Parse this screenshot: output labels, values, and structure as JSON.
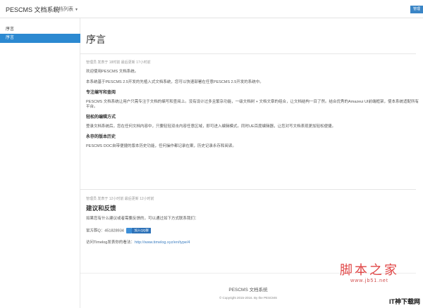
{
  "topbar": {
    "brand": "PESCMS 文档系统",
    "doc_list": "文档列表",
    "button": "管理"
  },
  "sidebar": {
    "heading": "序言",
    "active_item": "序言"
  },
  "main": {
    "title": "序言",
    "meta1": "管理员 发表于 18时前 最后更新 17小时前",
    "intro": "欢迎使用PESCMS 文档系统。",
    "p1": "本系统基于PESCMS 2.5开发的先植入式文档系统，您可以快速部署在任意PESCMS 2.5开发的系统中。",
    "h1": "专注编写和查阅",
    "p2": "PESCMS 文档系统让用户只需专注于文档的编写和查阅上。没有设计过多且繁杂功能，一级文档树 + 文档文章的组合，让文档结构一目了然。结合优秀的Amazeui UI前端框架，使本系统适配所有平台。",
    "h2": "轻松的编辑方式",
    "p3": "登录文档系统后，您在任何文档内容中，只要轻轻双击内容任意区域，即可进入编辑模式。同时UE百度编辑器，让您对写文档表现更加轻松便捷。",
    "h3": "永存的版本历史",
    "p4": "PESCMS DOC自带便捷的版本历史功能，任何操作都记录在案，历史记录永存和阅读。",
    "meta2": "管理员 发表于 12小时前 最后更新 12小时前",
    "h_feedback": "建议和反馈",
    "p5": "如果您有什么建议或者需要反馈的，可以通过如下方式联系我们：",
    "qq_label": "官方群Q：451828934",
    "qq_button": "加入QQ群",
    "p6_prefix": "访问Timelog发表你的看法：",
    "p6_link": "http://www.timelog.xyz/en/type/4"
  },
  "footer": {
    "title": "PESCMS 文档系统",
    "copyright": "© Copyright 2015-2016. By the PESCMS"
  },
  "watermark": {
    "text": "脚本之家",
    "url": "www.jb51.net",
    "corner": "IT神下载网"
  }
}
